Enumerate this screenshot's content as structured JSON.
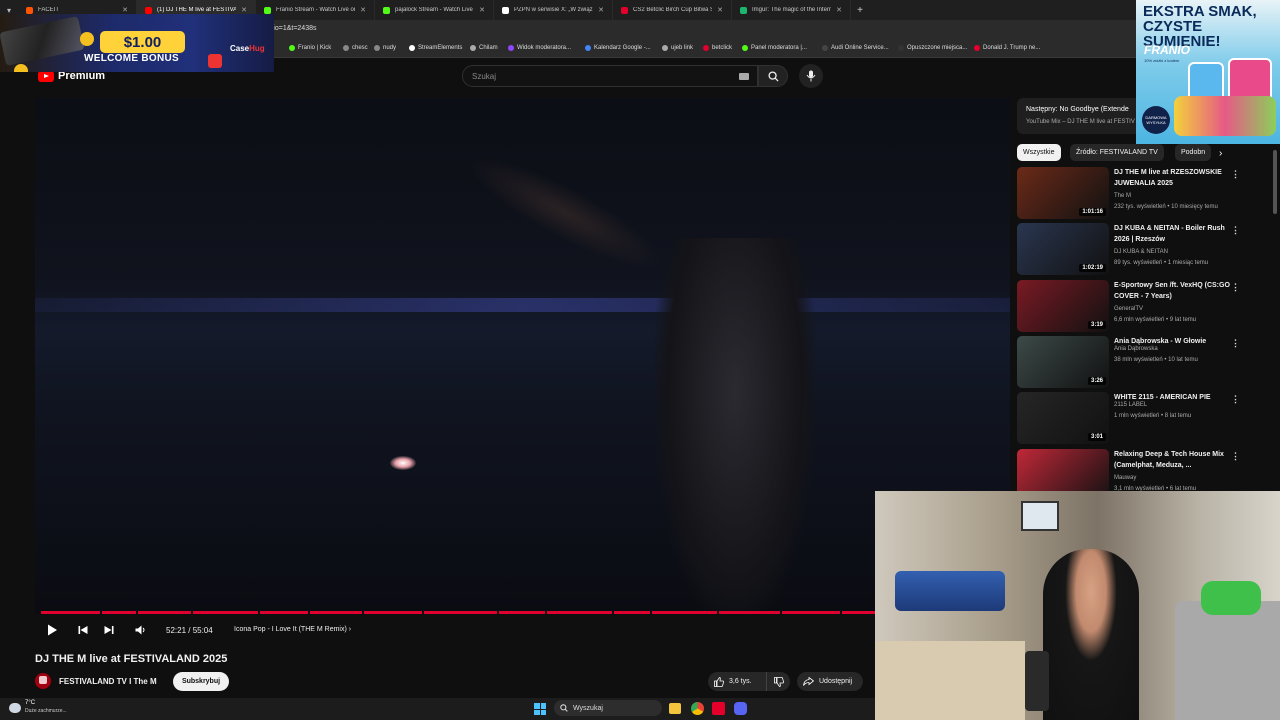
{
  "browser": {
    "tabs": [
      {
        "label": "FACEIT",
        "color": "#ff5500",
        "active": false
      },
      {
        "label": "(1) DJ THE M live at FESTIVALAND",
        "color": "#ff0000",
        "active": true
      },
      {
        "label": "Franio Stream - Watch Live on",
        "color": "#53fc18",
        "active": false
      },
      {
        "label": "pajalock Stream - Watch Live o",
        "color": "#53fc18",
        "active": false
      },
      {
        "label": "PZPN w serwisie X: „W związku",
        "color": "#ffffff",
        "active": false
      },
      {
        "label": "CS2 Betclic Birch Cup Bitwa Str",
        "color": "#e3002b",
        "active": false
      },
      {
        "label": "Imgur: The magic of the Interne",
        "color": "#1bb76e",
        "active": false
      }
    ],
    "new_tab": "+",
    "url": "rt_radio=1&t=2438s",
    "bookmarks": [
      {
        "label": "Franio | Kick",
        "color": "#53fc18"
      },
      {
        "label": "chesc",
        "color": "#888888"
      },
      {
        "label": "nudy",
        "color": "#888888"
      },
      {
        "label": "StreamElements",
        "color": "#ffffff"
      },
      {
        "label": "Chilam",
        "color": "#aaaaaa"
      },
      {
        "label": "Widok moderatora...",
        "color": "#9146ff"
      },
      {
        "label": "Kalendarz Google -...",
        "color": "#4285f4"
      },
      {
        "label": "ujeb link",
        "color": "#aaaaaa"
      },
      {
        "label": "betclick",
        "color": "#e3002b"
      },
      {
        "label": "Panel moderatora |...",
        "color": "#53fc18"
      },
      {
        "label": "Audi Online Service...",
        "color": "#444444"
      },
      {
        "label": "Opuszczone miejsca...",
        "color": "#333333"
      },
      {
        "label": "Donald J. Trump ne...",
        "color": "#e3002b"
      }
    ]
  },
  "youtube": {
    "logo_text": "Premium",
    "search_placeholder": "Szukaj"
  },
  "player": {
    "time": "52:21 / 55:04",
    "chapter": "Icona Pop - I Love It (THE M Remix)",
    "progress_fraction": 0.951
  },
  "video": {
    "title": "DJ THE M live at FESTIVALAND 2025",
    "channel": "FESTIVALAND TV I The M",
    "subscribe_label": "Subskrybuj",
    "likes": "3,6 tys.",
    "share_label": "Udostępnij"
  },
  "sidebar": {
    "up_next_title": "Następny: No Goodbye (Extende",
    "up_next_sub": "YouTube Mix – DJ THE M live at FESTIV",
    "chips": [
      "Wszystkie",
      "Źródło: FESTIVALAND TV",
      "Podobn"
    ],
    "recommendations": [
      {
        "title": "DJ THE M live at RZESZOWSKIE JUWENALIA 2025",
        "channel": "The M",
        "meta": "232 tys. wyświetleń • 10 miesięcy temu",
        "duration": "1:01:16",
        "thumb": "#6b2a18"
      },
      {
        "title": "DJ KUBA & NEITAN - Boiler Rush 2026 | Rzeszów",
        "channel": "DJ KUBA & NEITAN",
        "meta": "89 tys. wyświetleń • 1 miesiąc temu",
        "duration": "1:02:19",
        "thumb": "#2a3650"
      },
      {
        "title": "E-Sportowy Sen /ft. VexHQ (CS:GO COVER - 7 Years)",
        "channel": "GeneralTV",
        "meta": "6,6 mln wyświetleń • 9 lat temu",
        "duration": "3:19",
        "thumb": "#7a1a24"
      },
      {
        "title": "Ania Dąbrowska - W Głowie",
        "channel": "Ania Dąbrowska",
        "meta": "38 mln wyświetleń • 10 lat temu",
        "duration": "3:26",
        "thumb": "#3c4a48"
      },
      {
        "title": "WHITE 2115 - AMERICAN PIE",
        "channel": "2115 LABEL",
        "meta": "1 mln wyświetleń • 8 lat temu",
        "duration": "3:01",
        "thumb": "#262626"
      },
      {
        "title": "Relaxing Deep & Tech House Mix (Camelphat, Meduza, ...",
        "channel": "Mauway",
        "meta": "3,1 mln wyświetleń • 6 lat temu",
        "duration": "",
        "thumb": "#c02838"
      }
    ]
  },
  "ads": {
    "top_left_amount": "$1.00",
    "top_left_bonus": "WELCOME BONUS",
    "top_left_brand_a": "Case",
    "top_left_brand_b": "Hug",
    "top_right_headline": "EKSTRA SMAK, CZYSTE SUMIENIE!",
    "top_right_brand": "FRANIO",
    "top_right_sub": "10% zniżki z kodem",
    "top_right_badge": "DARMOWA WYSYŁKA"
  },
  "taskbar": {
    "weather_temp": "7°C",
    "weather_desc": "Duże zachmurze...",
    "search_label": "Wyszukaj"
  }
}
